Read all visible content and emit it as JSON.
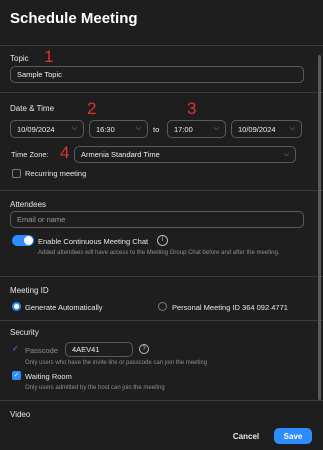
{
  "window": {
    "title": "Schedule Meeting"
  },
  "topic": {
    "label": "Topic",
    "value": "Sample Topic",
    "marker": "1"
  },
  "datetime": {
    "label": "Date & Time",
    "start_date": "10/09/2024",
    "start_time": "16:30",
    "to_label": "to",
    "end_time": "17:00",
    "end_date": "10/09/2024",
    "marker_start": "2",
    "marker_end": "3"
  },
  "timezone": {
    "label": "Time Zone:",
    "value": "Armenia Standard Time",
    "marker": "4"
  },
  "recurring": {
    "label": "Recurring meeting",
    "checked": false
  },
  "attendees": {
    "label": "Attendees",
    "placeholder": "Email or name",
    "chat_toggle_label": "Enable Continuous Meeting Chat",
    "chat_toggle_on": true,
    "chat_hint": "Added attendees will have access to the Meeting Group Chat before and after the meeting."
  },
  "meeting_id": {
    "label": "Meeting ID",
    "option_generate": "Generate Automatically",
    "option_personal": "Personal Meeting ID 364 092 4771",
    "selected": "generate"
  },
  "security": {
    "label": "Security",
    "passcode_label": "Passcode",
    "passcode_value": "4AEV41",
    "passcode_hint": "Only users who have the invite link or passcode can join the meeting",
    "waiting_room_label": "Waiting Room",
    "waiting_room_hint": "Only users admitted by the host can join the meeting"
  },
  "video": {
    "label": "Video"
  },
  "footer": {
    "cancel_label": "Cancel",
    "save_label": "Save"
  },
  "colors": {
    "accent": "#2d8cff",
    "marker": "#e03131",
    "background": "#1e1e1e"
  },
  "icons": [
    "chevron-down-icon",
    "info-icon",
    "help-icon",
    "checkmark-icon"
  ]
}
